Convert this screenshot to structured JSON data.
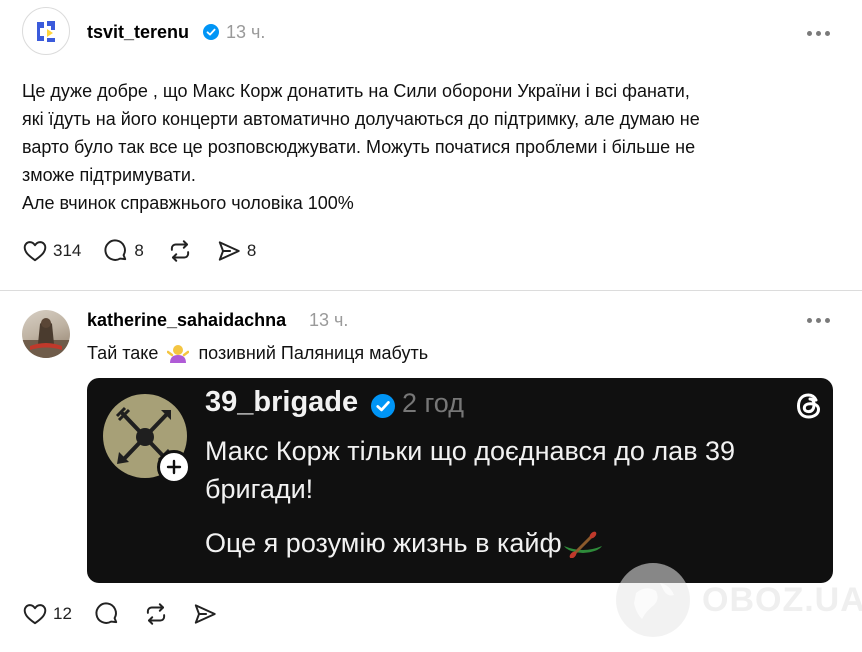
{
  "post": {
    "username": "tsvit_terenu",
    "time": "13 ч.",
    "lines": [
      "Це дуже добре , що Макс Корж донатить на Сили оборони України і всі фанати,",
      "які їдуть на його концерти автоматично долучаються до підтримку, але думаю не",
      "варто було так все це розповсюджувати. Можуть початися проблеми і більше не",
      "зможе підтримувати.",
      "Але вчинок справжнього чоловіка 100%"
    ],
    "likes": "314",
    "comments": "8",
    "shares": "8"
  },
  "reply": {
    "username": "katherine_sahaidachna",
    "time": "13 ч.",
    "text_before": "Тай таке",
    "text_after": "позивний Паляниця мабуть",
    "likes": "12"
  },
  "quote": {
    "username": "39_brigade",
    "time": "2 год",
    "line1": "Макс Корж тільки що доєднався до лав 39",
    "line2": "бригади!",
    "line3": "Оце я розумію жизнь в кайф"
  },
  "watermark": "OBOZ.UA",
  "icons": {
    "verified": "verified-badge-icon",
    "like": "heart-icon",
    "comment": "comment-icon",
    "repost": "repost-icon",
    "share": "share-icon",
    "more": "more-icon",
    "threads": "threads-logo-icon"
  },
  "colors": {
    "verified": "#0095f6",
    "muted": "#9a9a9a",
    "card_bg": "#101010"
  }
}
